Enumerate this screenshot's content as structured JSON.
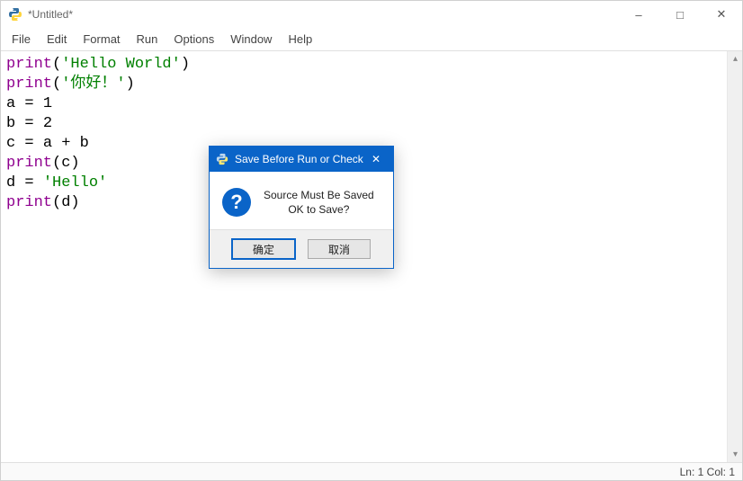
{
  "window": {
    "title": "*Untitled*"
  },
  "menu": {
    "items": [
      "File",
      "Edit",
      "Format",
      "Run",
      "Options",
      "Window",
      "Help"
    ]
  },
  "code_tokens": [
    [
      {
        "t": "print",
        "c": "builtin"
      },
      {
        "t": "(",
        "c": "paren"
      },
      {
        "t": "'Hello World'",
        "c": "str"
      },
      {
        "t": ")",
        "c": "paren"
      }
    ],
    [
      {
        "t": "print",
        "c": "builtin"
      },
      {
        "t": "(",
        "c": "paren"
      },
      {
        "t": "'你好！'",
        "c": "str"
      },
      {
        "t": ")",
        "c": "paren"
      }
    ],
    [
      {
        "t": "a ",
        "c": "id"
      },
      {
        "t": "= ",
        "c": "op"
      },
      {
        "t": "1",
        "c": "num"
      }
    ],
    [
      {
        "t": "b ",
        "c": "id"
      },
      {
        "t": "= ",
        "c": "op"
      },
      {
        "t": "2",
        "c": "num"
      }
    ],
    [
      {
        "t": "c ",
        "c": "id"
      },
      {
        "t": "= ",
        "c": "op"
      },
      {
        "t": "a ",
        "c": "id"
      },
      {
        "t": "+ ",
        "c": "op"
      },
      {
        "t": "b",
        "c": "id"
      }
    ],
    [
      {
        "t": "print",
        "c": "builtin"
      },
      {
        "t": "(",
        "c": "paren"
      },
      {
        "t": "c",
        "c": "id"
      },
      {
        "t": ")",
        "c": "paren"
      }
    ],
    [
      {
        "t": "d ",
        "c": "id"
      },
      {
        "t": "= ",
        "c": "op"
      },
      {
        "t": "'Hello'",
        "c": "str"
      }
    ],
    [
      {
        "t": "print",
        "c": "builtin"
      },
      {
        "t": "(",
        "c": "paren"
      },
      {
        "t": "d",
        "c": "id"
      },
      {
        "t": ")",
        "c": "paren"
      }
    ]
  ],
  "statusbar": {
    "position": "Ln: 1  Col: 1"
  },
  "dialog": {
    "title": "Save Before Run or Check",
    "message_line1": "Source Must Be Saved",
    "message_line2": "OK to Save?",
    "ok_label": "确定",
    "cancel_label": "取消",
    "question_glyph": "?"
  },
  "icons": {
    "python": "python-icon",
    "minimize": "–",
    "maximize": "□",
    "close": "✕",
    "scroll_up": "▴",
    "scroll_down": "▾",
    "dlg_close": "✕"
  }
}
